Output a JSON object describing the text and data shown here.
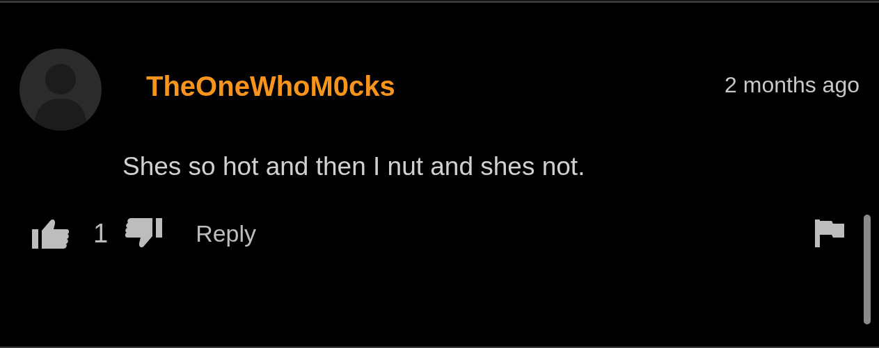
{
  "comment": {
    "username": "TheOneWhoM0cks",
    "time": "2 months ago",
    "text": "Shes so hot and then I nut and shes not.",
    "likes": "1",
    "reply": "Reply"
  }
}
